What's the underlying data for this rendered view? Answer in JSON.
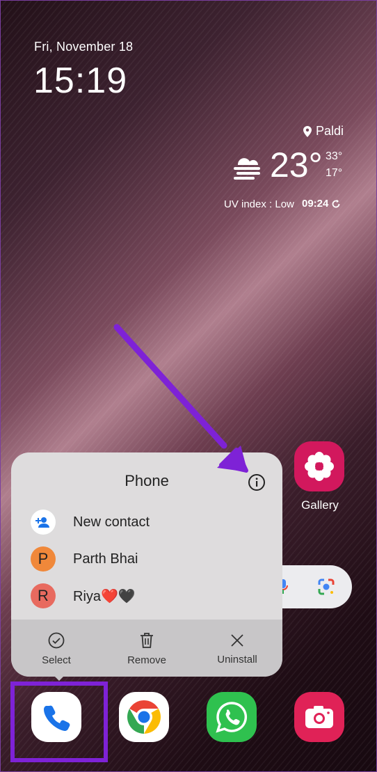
{
  "status": {
    "date": "Fri, November 18",
    "time": "15:19"
  },
  "weather": {
    "location": "Paldi",
    "temperature": "23°",
    "high": "33°",
    "low": "17°",
    "uv_index": "UV index : Low",
    "updated": "09:24"
  },
  "apps": {
    "gallery_label": "Gallery"
  },
  "popup": {
    "title": "Phone",
    "items": [
      {
        "label": "New contact",
        "avatar": ""
      },
      {
        "label": "Parth Bhai",
        "avatar": "P"
      },
      {
        "label": "Riya",
        "avatar": "R",
        "emoji": "❤️🖤"
      }
    ],
    "actions": [
      {
        "label": "Select"
      },
      {
        "label": "Remove"
      },
      {
        "label": "Uninstall"
      }
    ]
  },
  "colors": {
    "accent": "#7e22d6",
    "gallery": "#d2185d",
    "whatsapp": "#2fc14f",
    "camera": "#e02257"
  }
}
